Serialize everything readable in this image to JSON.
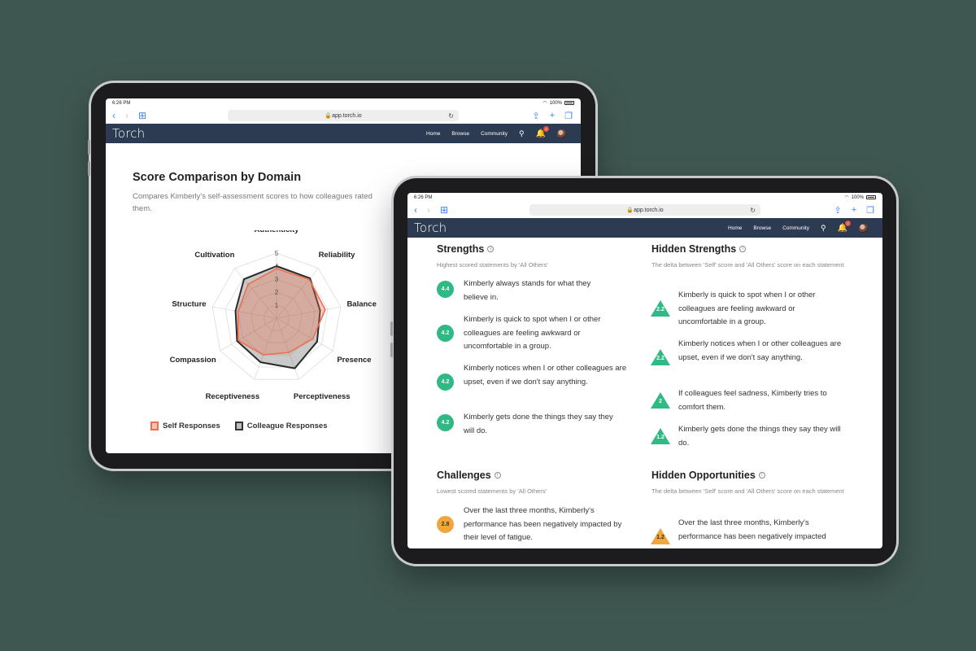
{
  "colors": {
    "background": "#3f5751",
    "nav": "#2c3b52",
    "green": "#2fb985",
    "orange": "#f0a63a",
    "self": "#ec6f4f",
    "colleague": "#333333"
  },
  "status": {
    "time": "6:26 PM",
    "battery": "100%"
  },
  "browser": {
    "url": "app.torch.io"
  },
  "app": {
    "brand": "Torch",
    "nav": [
      "Home",
      "Browse",
      "Community"
    ],
    "notifications": "2"
  },
  "score": {
    "title": "Score Comparison by Domain",
    "subtitle": "Compares Kimberly's self-assessment scores to how colleagues rated them.",
    "legend_self": "Self Responses",
    "legend_colleague": "Colleague Responses"
  },
  "chart_data": {
    "type": "radar",
    "axes": [
      "Authenticity",
      "Reliability",
      "Balance",
      "Presence",
      "Perceptiveness",
      "Receptiveness",
      "Compassion",
      "Structure",
      "Cultivation"
    ],
    "ticks": [
      "1",
      "2",
      "3",
      "4",
      "5"
    ],
    "rmax": 5,
    "series": [
      {
        "name": "Self Responses",
        "values": [
          3.8,
          3.9,
          3.8,
          3.2,
          2.8,
          3.0,
          3.4,
          3.0,
          3.4
        ]
      },
      {
        "name": "Colleague Responses",
        "values": [
          4.0,
          4.0,
          3.4,
          3.6,
          4.1,
          3.6,
          3.5,
          3.2,
          3.9
        ]
      }
    ]
  },
  "strengths": {
    "title": "Strengths",
    "subtitle": "Highest scored statements by 'All Others'",
    "items": [
      {
        "score": "4.4",
        "text": "Kimberly always stands for what they believe in."
      },
      {
        "score": "4.2",
        "text": "Kimberly is quick to spot when I or other colleagues are feeling awkward or uncomfortable in a group."
      },
      {
        "score": "4.2",
        "text": "Kimberly notices when I or other colleagues are upset, even if we don't say anything."
      },
      {
        "score": "4.2",
        "text": "Kimberly gets done the things they say they will do."
      }
    ]
  },
  "hidden_strengths": {
    "title": "Hidden Strengths",
    "subtitle": "The delta between 'Self' score and 'All Others' score on each statement",
    "items": [
      {
        "score": "2.2",
        "text": "Kimberly is quick to spot when I or other colleagues are feeling awkward or uncomfortable in a group."
      },
      {
        "score": "2.2",
        "text": "Kimberly notices when I or other colleagues are upset, even if we don't say anything."
      },
      {
        "score": "2",
        "text": "If colleagues feel sadness, Kimberly tries to comfort them."
      },
      {
        "score": "1.2",
        "text": "Kimberly gets done the things they say they will do."
      }
    ]
  },
  "challenges": {
    "title": "Challenges",
    "subtitle": "Lowest scored statements by 'All Others'",
    "items": [
      {
        "score": "2.8",
        "text": "Over the last three months, Kimberly's performance has been negatively impacted by their level of fatigue."
      }
    ]
  },
  "hidden_opportunities": {
    "title": "Hidden Opportunities",
    "subtitle": "The delta between 'Self' score and 'All Others' score on each statement",
    "items": [
      {
        "score": "1.2",
        "text": "Over the last three months, Kimberly's performance has been negatively impacted"
      }
    ]
  }
}
